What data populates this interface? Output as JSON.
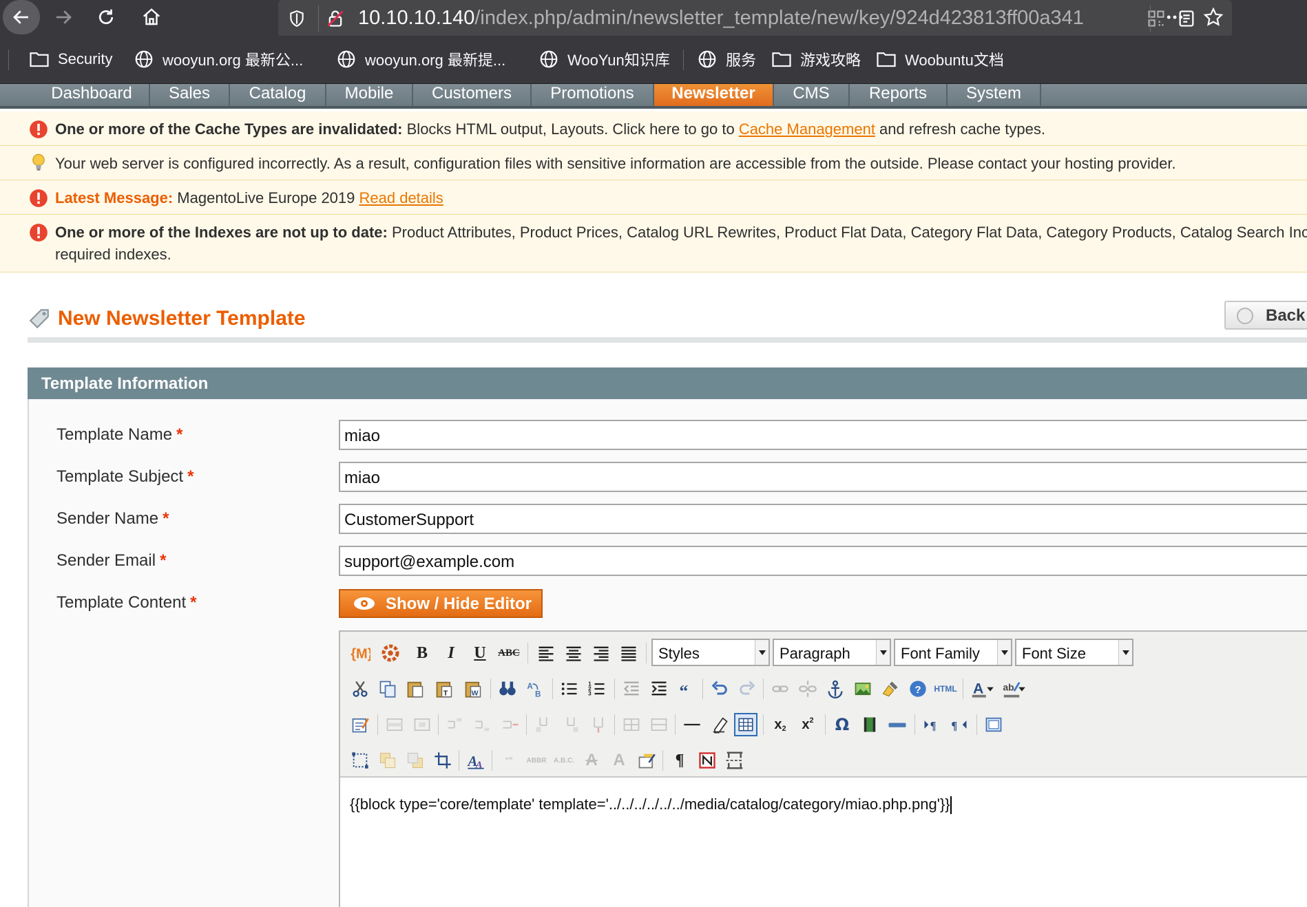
{
  "browser": {
    "url_host": "10.10.10.140",
    "url_path": "/index.php/admin/newsletter_template/new/key/924d423813ff00a341",
    "bookmarks": [
      "Security",
      "wooyun.org 最新公...",
      "wooyun.org 最新提...",
      "WooYun知识库",
      "服务",
      "游戏攻略",
      "Woobuntu文档"
    ]
  },
  "nav": {
    "items": [
      "Dashboard",
      "Sales",
      "Catalog",
      "Mobile",
      "Customers",
      "Promotions",
      "Newsletter",
      "CMS",
      "Reports",
      "System"
    ],
    "active": "Newsletter"
  },
  "messages": {
    "cache": {
      "bold": "One or more of the Cache Types are invalidated:",
      "text": " Blocks HTML output, Layouts. Click here to go to ",
      "link": "Cache Management",
      "tail": " and refresh cache types."
    },
    "server": {
      "text": "Your web server is configured incorrectly. As a result, configuration files with sensitive information are accessible from the outside. Please contact your hosting provider."
    },
    "latest": {
      "bold": "Latest Message:",
      "text": " MagentoLive Europe 2019 ",
      "link": "Read details"
    },
    "indexes": {
      "bold": "One or more of the Indexes are not up to date:",
      "text": " Product Attributes, Product Prices, Catalog URL Rewrites, Product Flat Data, Category Flat Data, Category Products, Catalog Search Inc",
      "line2": "required indexes."
    }
  },
  "page": {
    "title": "New Newsletter Template",
    "back_label": "Back"
  },
  "form": {
    "section_title": "Template Information",
    "fields": [
      {
        "label": "Template Name",
        "value": "miao"
      },
      {
        "label": "Template Subject",
        "value": "miao"
      },
      {
        "label": "Sender Name",
        "value": "CustomerSupport"
      },
      {
        "label": "Sender Email",
        "value": "support@example.com"
      }
    ],
    "content_label": "Template Content",
    "required_mark": "*",
    "show_hide_label": "Show / Hide Editor"
  },
  "editor": {
    "styles": "Styles",
    "format": "Paragraph",
    "font_family": "Font Family",
    "font_size": "Font Size",
    "content": "{{block type='core/template' template='../../../../../../media/catalog/category/miao.php.png'}}"
  },
  "colors": {
    "accent": "#eb5e00",
    "nav_active": "#e8791f",
    "section_header": "#6f8992",
    "message_bg": "#fff9e9"
  }
}
